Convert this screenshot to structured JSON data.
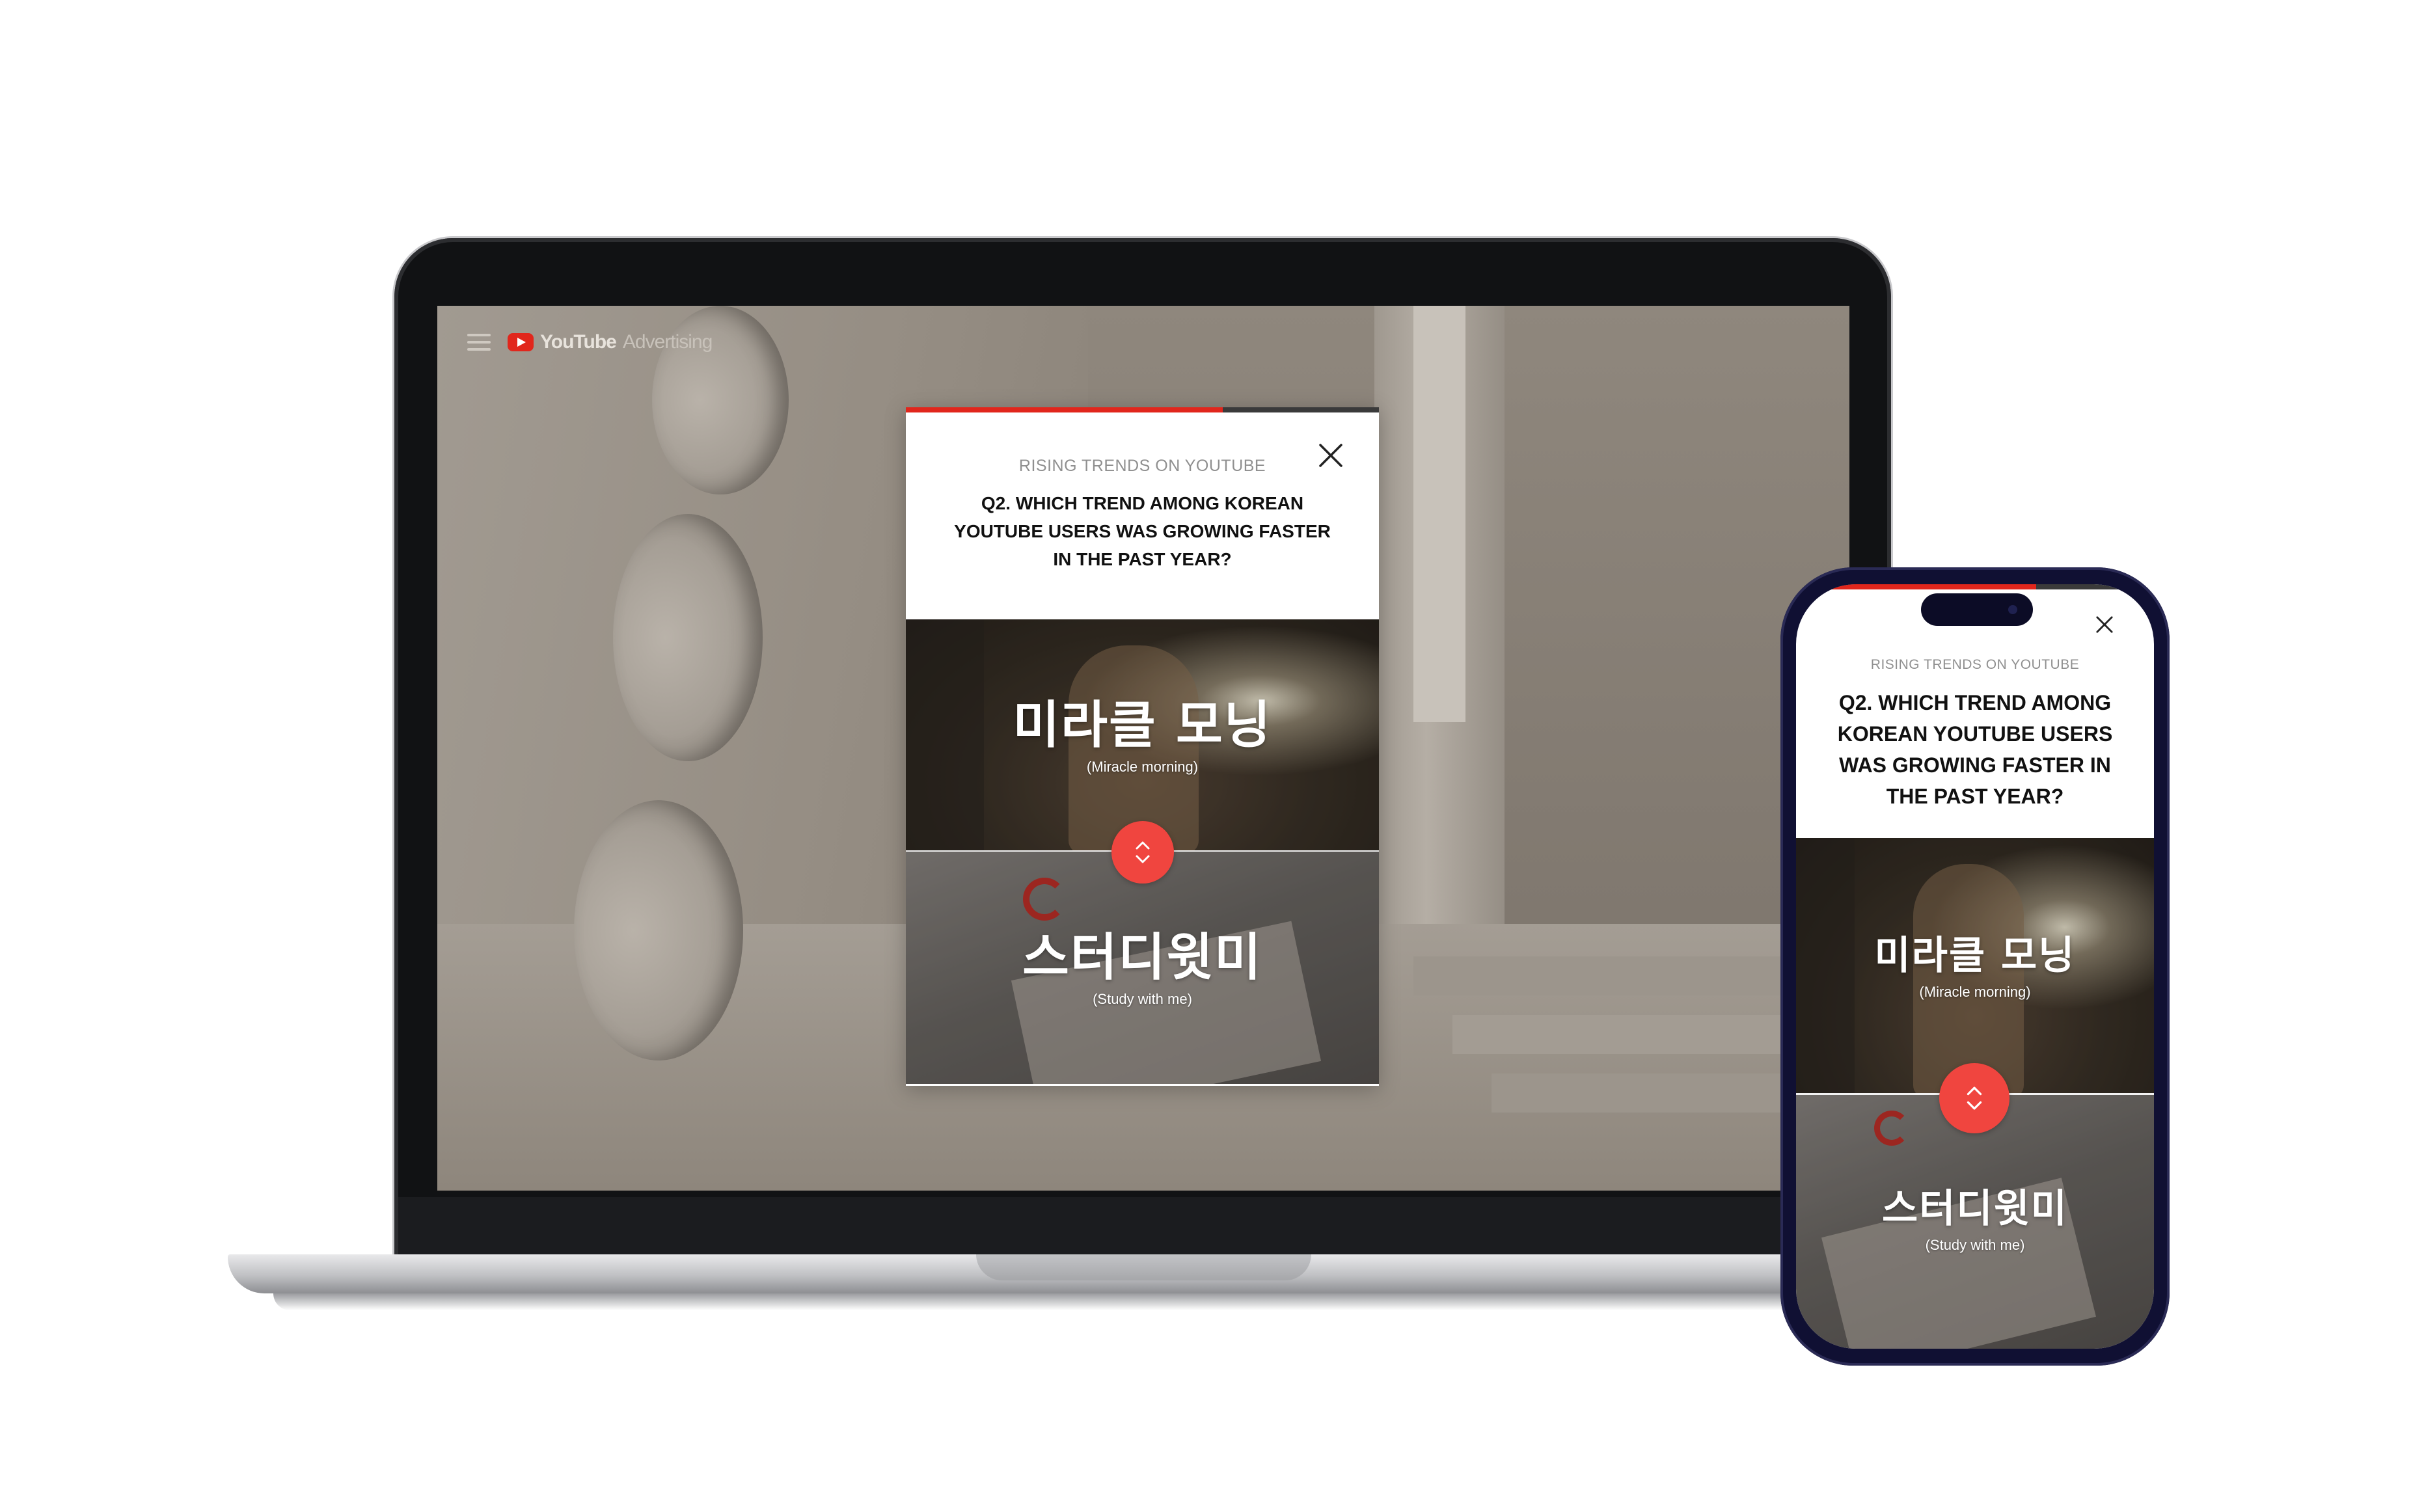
{
  "laptop": {
    "app": {
      "brand_main": "YouTube",
      "brand_suffix": "Advertising",
      "menu_icon": "hamburger-icon",
      "logo_icon": "youtube-play-icon"
    }
  },
  "quiz": {
    "kicker": "RISING TRENDS ON YOUTUBE",
    "question": "Q2. WHICH TREND AMONG KOREAN YOUTUBE USERS WAS GROWING FASTER IN THE PAST YEAR?",
    "progress": 0.67,
    "options": [
      {
        "title": "미라클 모닝",
        "subtitle": "(Miracle morning)"
      },
      {
        "title": "스터디윗미",
        "subtitle": "(Study with me)"
      }
    ],
    "close_icon": "close-icon",
    "swap_icon": "swap-vertical-icon"
  },
  "colors": {
    "accent": "#e1261c",
    "swap_button": "#f0453f",
    "phone_frame": "#101033"
  }
}
